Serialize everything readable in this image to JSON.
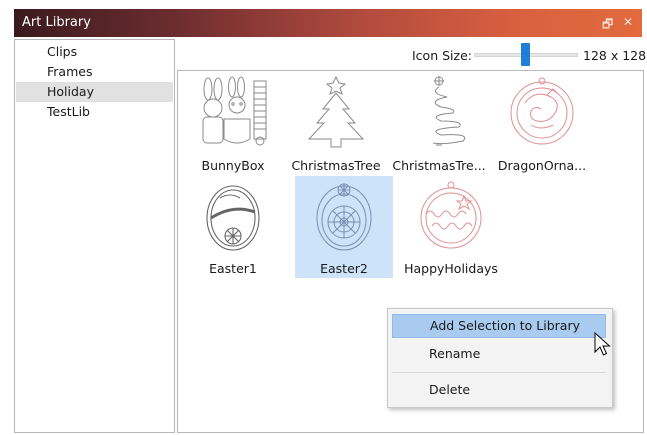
{
  "window": {
    "title": "Art Library",
    "icons": [
      "float-window-icon",
      "close-icon"
    ],
    "float_glyph": "🗗",
    "close_glyph": "✕"
  },
  "categories": [
    {
      "label": "Clips",
      "selected": false
    },
    {
      "label": "Frames",
      "selected": false
    },
    {
      "label": "Holiday",
      "selected": true
    },
    {
      "label": "TestLib",
      "selected": false
    }
  ],
  "toolbar": {
    "icon_size_label": "Icon Size:",
    "icon_size_value": "128 x 128",
    "slider_position_fraction": 0.45,
    "accent_color": "#1e7fd6"
  },
  "items": [
    {
      "label": "BunnyBox",
      "selected": false,
      "icon": "bunny-box-icon"
    },
    {
      "label": "ChristmasTree",
      "selected": false,
      "icon": "christmas-tree-icon"
    },
    {
      "label": "ChristmasTre...",
      "selected": false,
      "icon": "swirl-christmas-tree-icon"
    },
    {
      "label": "DragonOrna...",
      "selected": false,
      "icon": "dragon-ornament-icon"
    },
    {
      "label": "Easter1",
      "selected": false,
      "icon": "easter-egg-icon"
    },
    {
      "label": "Easter2",
      "selected": true,
      "icon": "mandala-egg-icon"
    },
    {
      "label": "HappyHolidays",
      "selected": false,
      "icon": "happy-holidays-ornament-icon"
    }
  ],
  "context_menu": {
    "items": [
      "Add Selection to Library",
      "Rename",
      "Delete"
    ],
    "highlighted": "Add Selection to Library"
  },
  "colors": {
    "title_gradient_start": "#3a1a1e",
    "title_gradient_end": "#e26a3d",
    "selection": "#cde3f8",
    "menu_highlight": "#a9cbf0"
  }
}
